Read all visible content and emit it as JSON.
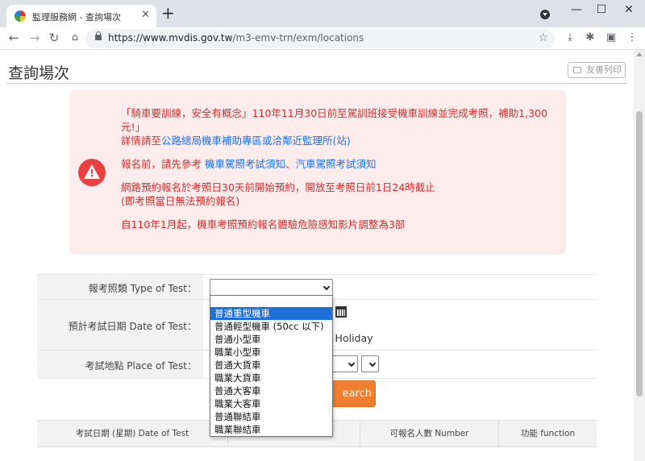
{
  "browser": {
    "tab_title": "監理服務網 - 查詢場次",
    "tab_close": "✕",
    "new_tab": "+",
    "url_host": "https://www.mvdis.gov.tw",
    "url_path": "/m3-emv-trn/exm/locations",
    "back": "←",
    "forward": "→",
    "reload": "↻",
    "star": "☆",
    "download": "⤓",
    "extensions": "✱",
    "minimize": "—",
    "maximize": "☐",
    "close": "✕"
  },
  "page": {
    "title": "查詢場次",
    "print_label": "友善列印"
  },
  "alert": {
    "line1": "「騎車要訓練，安全有概念」110年11月30日前至駕訓班接受機車訓練並完成考照，補助1,300元!」",
    "line2_prefix": "詳情請至",
    "line2_link": "公路總局機車補助專區或洽鄰近監理所(站)",
    "line3_prefix": "報名前，請先參考 ",
    "line3_link1": "機車駕照考試須知",
    "line3_sep": "、",
    "line3_link2": "汽車駕照考試須知",
    "line4a": "網路預約報名於考照日30天前開始預約，開放至考照日前1日24時截止",
    "line4b": "(即考照當日無法預約報名)",
    "line5": "自110年1月起，機車考照預約報名體驗危險感知影片調整為3部"
  },
  "form": {
    "type_label": "報考照類 Type of Test：",
    "date_label": "預計考試日期 Date of Test：",
    "place_label": "考試地點 Place of Test：",
    "holiday_text": "on Holiday",
    "search_label": "earch"
  },
  "results": {
    "columns": [
      "考試日期 (星期) Date of Test",
      "",
      "可報名人數 Number",
      "功能 function"
    ]
  },
  "dropdown": {
    "options": [
      "普通重型機車",
      "普通輕型機車 (50cc 以下)",
      "普通小型車",
      "職業小型車",
      "普通大貨車",
      "職業大貨車",
      "普通大客車",
      "職業大客車",
      "普通聯結車",
      "職業聯結車"
    ],
    "selected_index": 0
  }
}
